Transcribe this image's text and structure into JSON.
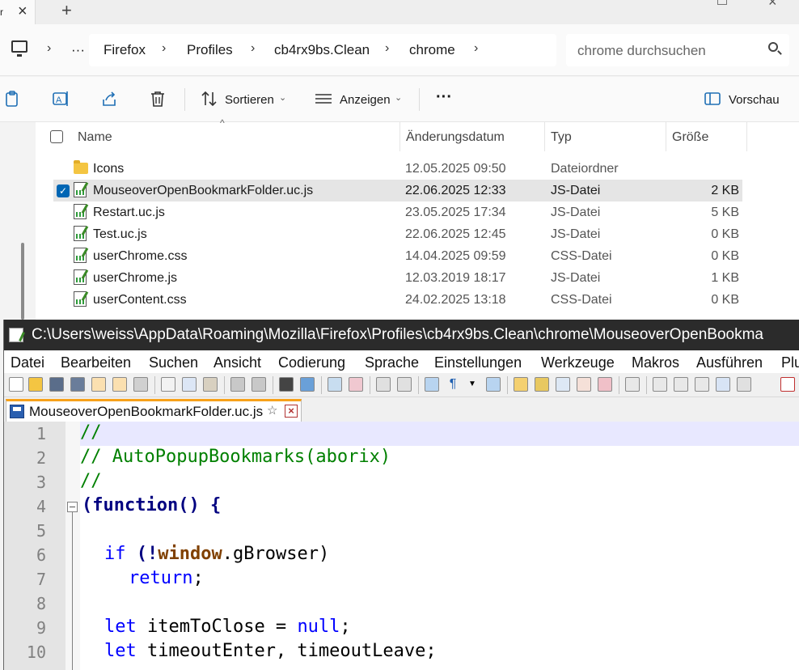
{
  "explorer": {
    "tabbar": {
      "close_glyph": "×",
      "new_tab_glyph": "+",
      "edge_glyph": "r"
    },
    "breadcrumb": {
      "more": "···",
      "items": [
        "Firefox",
        "Profiles",
        "cb4rx9bs.Clean",
        "chrome"
      ]
    },
    "search": {
      "placeholder": "chrome durchsuchen"
    },
    "commands": {
      "sort_label": "Sortieren",
      "view_label": "Anzeigen",
      "more": "···",
      "preview_label": "Vorschau"
    },
    "columns": {
      "name": "Name",
      "date": "Änderungsdatum",
      "type": "Typ",
      "size": "Größe"
    },
    "files": [
      {
        "name": "Icons",
        "date": "12.05.2025 09:50",
        "type": "Dateiordner",
        "size": "",
        "kind": "folder"
      },
      {
        "name": "MouseoverOpenBookmarkFolder.uc.js",
        "date": "22.06.2025 12:33",
        "type": "JS-Datei",
        "size": "2 KB",
        "kind": "file",
        "selected": true
      },
      {
        "name": "Restart.uc.js",
        "date": "23.05.2025 17:34",
        "type": "JS-Datei",
        "size": "5 KB",
        "kind": "file"
      },
      {
        "name": "Test.uc.js",
        "date": "22.06.2025 12:45",
        "type": "JS-Datei",
        "size": "0 KB",
        "kind": "file"
      },
      {
        "name": "userChrome.css",
        "date": "14.04.2025 09:59",
        "type": "CSS-Datei",
        "size": "0 KB",
        "kind": "file"
      },
      {
        "name": "userChrome.js",
        "date": "12.03.2019 18:17",
        "type": "JS-Datei",
        "size": "1 KB",
        "kind": "file"
      },
      {
        "name": "userContent.css",
        "date": "24.02.2025 13:18",
        "type": "CSS-Datei",
        "size": "0 KB",
        "kind": "file"
      }
    ]
  },
  "notepad": {
    "title": "C:\\Users\\weiss\\AppData\\Roaming\\Mozilla\\Firefox\\Profiles\\cb4rx9bs.Clean\\chrome\\MouseoverOpenBookma",
    "menu": [
      "Datei",
      "Bearbeiten",
      "Suchen",
      "Ansicht",
      "Codierung",
      "Sprache",
      "Einstellungen",
      "Werkzeuge",
      "Makros",
      "Ausführen",
      "Plu"
    ],
    "tab": {
      "label": "MouseoverOpenBookmarkFolder.uc.js",
      "pin": "☆",
      "close": "×"
    },
    "line_numbers": [
      "1",
      "2",
      "3",
      "4",
      "5",
      "6",
      "7",
      "8",
      "9",
      "10"
    ],
    "code": {
      "l1": "//",
      "l2": "// AutoPopupBookmarks(aborix)",
      "l3": "//",
      "l4_a": "(function",
      "l4_b": "() {",
      "l6_kw": "if",
      "l6_a": " (",
      "l6_op": "!",
      "l6_obj": "window",
      "l6_b": ".gBrowser)",
      "l7_kw": "return",
      "l7_b": ";",
      "l9_kw": "let",
      "l9_a": " itemToClose = ",
      "l9_null": "null",
      "l9_b": ";",
      "l10_kw": "let",
      "l10_a": " timeoutEnter, timeoutLeave;"
    }
  }
}
